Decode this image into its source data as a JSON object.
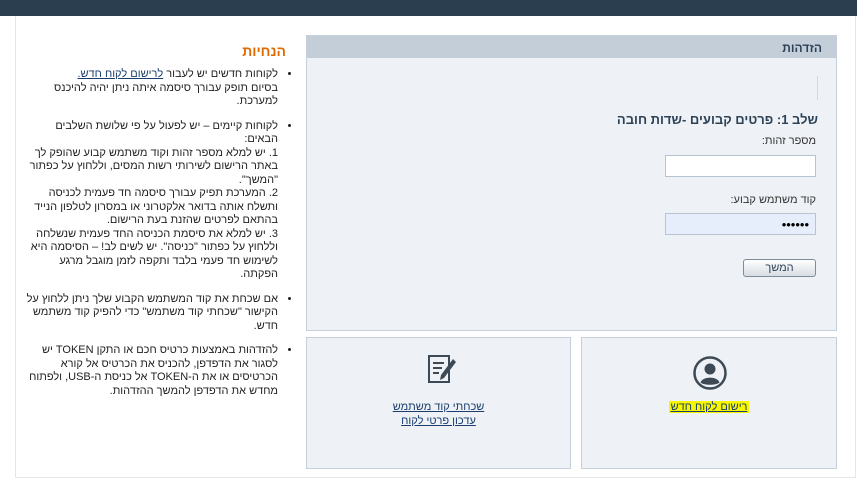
{
  "panel": {
    "title": "הזדהות",
    "step_title": "שלב 1: פרטים קבועים -שדות חובה",
    "id_label": "מספר זהות:",
    "id_value": "",
    "user_code_label": "קוד משתמש קבוע:",
    "user_code_value": "••••••",
    "continue_label": "המשך"
  },
  "cards": {
    "register_link": "רישום לקוח חדש",
    "forgot_link": "שכחתי קוד משתמש",
    "update_link": "עדכון פרטי לקוח",
    "register_icon": "user-circle-icon",
    "forgot_icon": "edit-document-icon"
  },
  "instructions": {
    "title": "הנחיות",
    "item1": {
      "prefix": "לקוחות חדשים יש לעבור ",
      "link": "לרישום לקוח חדש.",
      "rest": "בסיום תופק עבורך סיסמה איתה ניתן יהיה להיכנס למערכת."
    },
    "item2": {
      "intro": "לקוחות קיימים – יש לפעול על פי שלושת השלבים הבאים:",
      "step1": "1. יש למלא מספר זהות וקוד משתמש קבוע שהופק לך באתר הרישום לשירותי רשות המסים, וללחוץ על כפתור \"המשך\".",
      "step2": "2. המערכת תפיק עבורך סיסמה חד פעמית לכניסה ותשלח אותה בדואר אלקטרוני או במסרון לטלפון הנייד בהתאם לפרטים שהזנת בעת הרישום.",
      "step3": "3. יש למלא את סיסמת הכניסה החד פעמית שנשלחה וללחוץ על כפתור \"כניסה\". יש לשים לב! – הסיסמה היא לשימוש חד פעמי בלבד ותקפה לזמן מוגבל מרגע הפקתה."
    },
    "item3": "אם שכחת את קוד המשתמש הקבוע שלך ניתן ללחוץ על הקישור \"שכחתי קוד משתמש\" כדי להפיק קוד משתמש חדש.",
    "item4": "להזדהות באמצעות כרטיס חכם או התקן TOKEN יש לסגור את הדפדפן, להכניס את הכרטיס אל קורא הכרטיסים או את ה-TOKEN אל כניסת ה-USB, ולפתוח מחדש את הדפדפן להמשך ההזדהות."
  },
  "colors": {
    "topbar": "#2b3e50",
    "panel_header": "#c3ced9",
    "panel_bg": "#eef2f6",
    "instructions_title": "#e06a00",
    "link": "#1a3d6d",
    "highlight": "#f6f700"
  }
}
